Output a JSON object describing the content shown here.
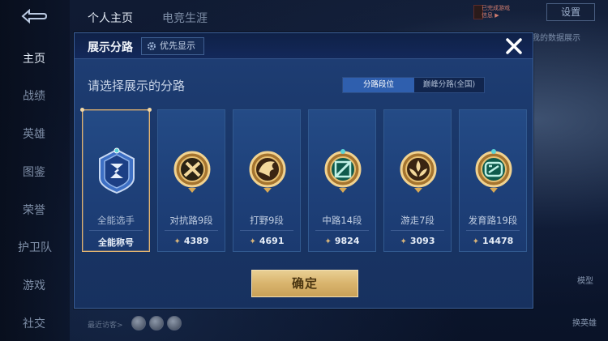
{
  "sidebar": {
    "items": [
      {
        "label": "主页",
        "active": true
      },
      {
        "label": "战绩"
      },
      {
        "label": "英雄"
      },
      {
        "label": "图鉴"
      },
      {
        "label": "荣誉"
      },
      {
        "label": "护卫队"
      },
      {
        "label": "游戏"
      },
      {
        "label": "社交"
      }
    ]
  },
  "topbar": {
    "tabs": [
      "个人主页",
      "电竞生涯"
    ],
    "badge_text": "已完成游戏\n信息 ▶",
    "settings_label": "设置"
  },
  "background": {
    "data_display_text": "看我的数据展示",
    "model_label": "模型",
    "switch_hero_label": "换英雄",
    "recent_visitors": "最近访客>"
  },
  "modal": {
    "title": "展示分路",
    "priority_label": "优先显示",
    "instruction": "请选择展示的分路",
    "toggle": {
      "active": "分路段位",
      "idle": "巅峰分路(全国)"
    },
    "cards": [
      {
        "label": "全能选手",
        "value": "全能称号",
        "selected": true,
        "icon": "all-round-emblem-icon"
      },
      {
        "label": "对抗路9段",
        "value": "4389",
        "icon": "clash-lane-emblem-icon"
      },
      {
        "label": "打野9段",
        "value": "4691",
        "icon": "jungle-emblem-icon"
      },
      {
        "label": "中路14段",
        "value": "9824",
        "icon": "mid-lane-emblem-icon"
      },
      {
        "label": "游走7段",
        "value": "3093",
        "icon": "roam-emblem-icon"
      },
      {
        "label": "发育路19段",
        "value": "14478",
        "icon": "farm-lane-emblem-icon"
      }
    ],
    "confirm_label": "确定"
  },
  "colors": {
    "accent_gold": "#e2b370",
    "modal_blue": "#1f3f76",
    "button_gold": "#d9b46d"
  }
}
